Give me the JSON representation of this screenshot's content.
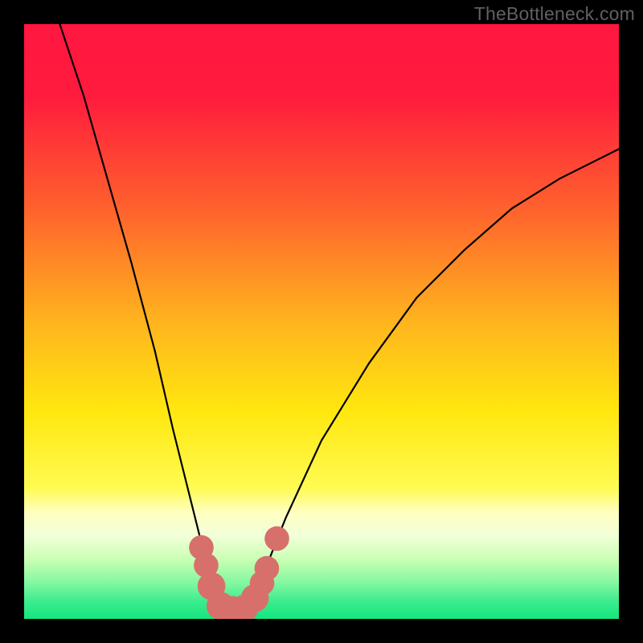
{
  "watermark": "TheBottleneck.com",
  "chart_data": {
    "type": "line",
    "title": "",
    "xlabel": "",
    "ylabel": "",
    "xlim": [
      0,
      100
    ],
    "ylim": [
      0,
      100
    ],
    "gradient_stops": [
      {
        "offset": 0,
        "color": "#ff173f"
      },
      {
        "offset": 0.12,
        "color": "#ff1b3e"
      },
      {
        "offset": 0.3,
        "color": "#ff5d2e"
      },
      {
        "offset": 0.5,
        "color": "#ffb41e"
      },
      {
        "offset": 0.65,
        "color": "#ffe70f"
      },
      {
        "offset": 0.78,
        "color": "#fffb52"
      },
      {
        "offset": 0.82,
        "color": "#ffffbf"
      },
      {
        "offset": 0.86,
        "color": "#f3ffd9"
      },
      {
        "offset": 0.9,
        "color": "#c9ffb3"
      },
      {
        "offset": 0.94,
        "color": "#82f7a0"
      },
      {
        "offset": 0.97,
        "color": "#3dec8e"
      },
      {
        "offset": 1.0,
        "color": "#14e57f"
      }
    ],
    "series": [
      {
        "name": "bottleneck-curve",
        "x": [
          6,
          10,
          14,
          18,
          22,
          25,
          28,
          30,
          31.5,
          33,
          35,
          37,
          38.5,
          40,
          44,
          50,
          58,
          66,
          74,
          82,
          90,
          98,
          100
        ],
        "y": [
          100,
          88,
          74,
          60,
          45,
          32,
          20,
          12,
          7,
          3,
          1.5,
          1.5,
          3,
          7,
          17,
          30,
          43,
          54,
          62,
          69,
          74,
          78,
          79
        ]
      }
    ],
    "markers": {
      "name": "highlight-points",
      "color": "#d7706a",
      "points": [
        {
          "x": 29.8,
          "y": 12.0,
          "r": 1.4
        },
        {
          "x": 30.6,
          "y": 9.0,
          "r": 1.4
        },
        {
          "x": 31.5,
          "y": 5.5,
          "r": 1.7
        },
        {
          "x": 33.0,
          "y": 2.2,
          "r": 1.7
        },
        {
          "x": 35.0,
          "y": 1.5,
          "r": 1.7
        },
        {
          "x": 37.0,
          "y": 1.7,
          "r": 1.7
        },
        {
          "x": 38.8,
          "y": 3.5,
          "r": 1.7
        },
        {
          "x": 40.0,
          "y": 6.0,
          "r": 1.4
        },
        {
          "x": 40.8,
          "y": 8.5,
          "r": 1.4
        },
        {
          "x": 42.5,
          "y": 13.5,
          "r": 1.4
        }
      ]
    }
  }
}
